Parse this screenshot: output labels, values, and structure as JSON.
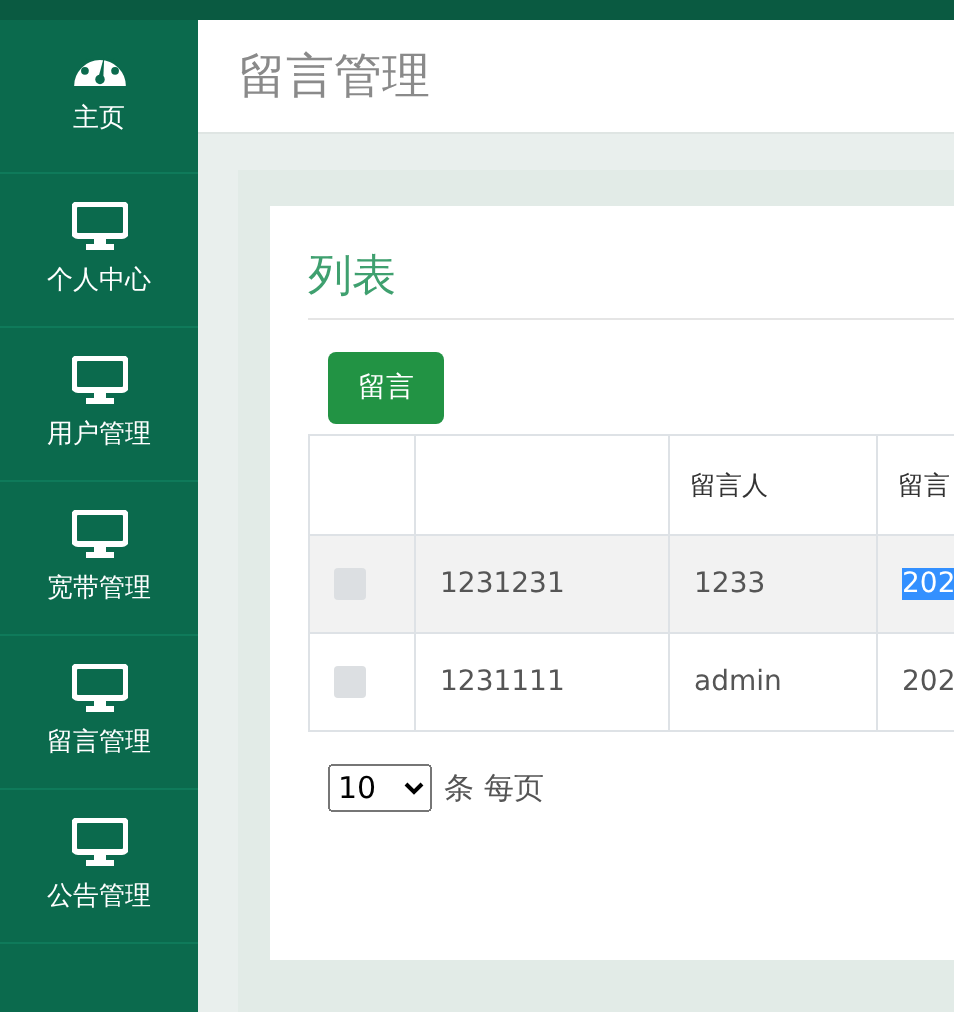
{
  "sidebar": {
    "items": [
      {
        "label": "主页",
        "selected": false
      },
      {
        "label": "个人中心",
        "selected": false
      },
      {
        "label": "用户管理",
        "selected": false
      },
      {
        "label": "宽带管理",
        "selected": false
      },
      {
        "label": "留言管理",
        "selected": false
      },
      {
        "label": "公告管理",
        "selected": false
      }
    ]
  },
  "header": {
    "title": "留言管理"
  },
  "card": {
    "title": "列表",
    "add_button": "留言",
    "table": {
      "columns": [
        "",
        "留言人",
        "留言"
      ],
      "rows": [
        {
          "checked": false,
          "hovered": true,
          "cells": [
            "1231231",
            "1233",
            "202"
          ],
          "last_cell_text_selected": true
        },
        {
          "checked": false,
          "hovered": false,
          "cells": [
            "1231111",
            "admin",
            "202"
          ],
          "last_cell_text_selected": false
        }
      ]
    },
    "page_size": {
      "value": "10",
      "label": "条 每页"
    }
  }
}
